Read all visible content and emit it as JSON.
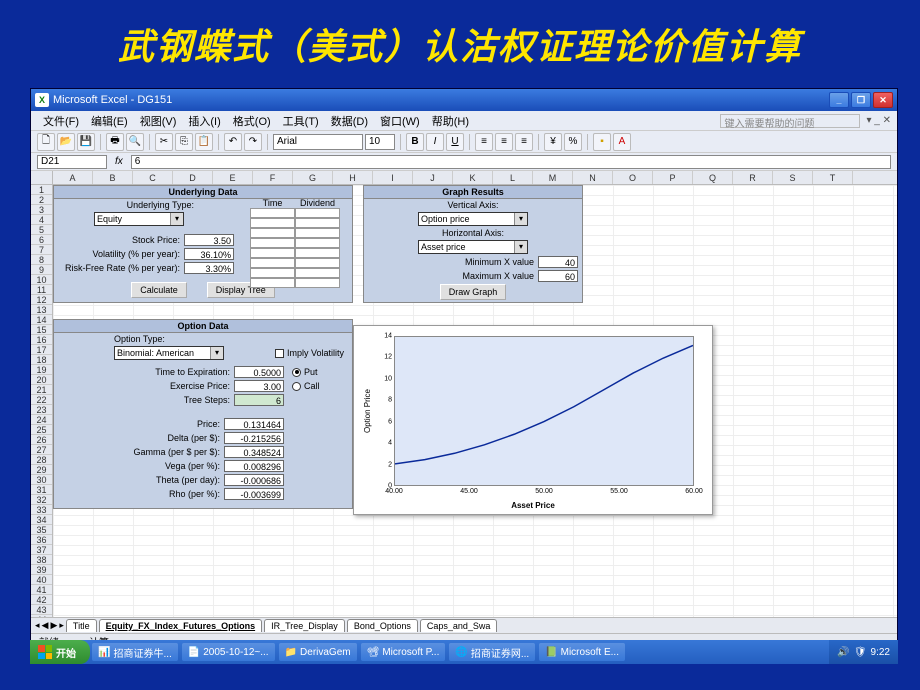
{
  "slide_title": "武钢蝶式（美式）认沽权证理论价值计算",
  "window": {
    "title": "Microsoft Excel - DG151"
  },
  "menubar": {
    "items": [
      "文件(F)",
      "编辑(E)",
      "视图(V)",
      "插入(I)",
      "格式(O)",
      "工具(T)",
      "数据(D)",
      "窗口(W)",
      "帮助(H)"
    ],
    "help_placeholder": "键入需要帮助的问题"
  },
  "formatbar": {
    "font": "Arial",
    "size": "10"
  },
  "namebox": {
    "cell": "D21",
    "fx": "fx",
    "value": "6"
  },
  "columns": [
    "A",
    "B",
    "C",
    "D",
    "E",
    "F",
    "G",
    "H",
    "I",
    "J",
    "K",
    "L",
    "M",
    "N",
    "O",
    "P",
    "Q",
    "R",
    "S",
    "T"
  ],
  "row_count": 45,
  "underlying": {
    "title": "Underlying Data",
    "type_label": "Underlying Type:",
    "type_value": "Equity",
    "time_label": "Time",
    "dividend_label": "Dividend",
    "stock_price_label": "Stock Price:",
    "stock_price": "3.50",
    "vol_label": "Volatility (% per year):",
    "vol": "36.10%",
    "rf_label": "Risk-Free Rate (% per year):",
    "rf": "3.30%",
    "calc_btn": "Calculate",
    "tree_btn": "Display Tree"
  },
  "graph": {
    "title": "Graph Results",
    "vaxis_label": "Vertical Axis:",
    "vaxis": "Option price",
    "haxis_label": "Horizontal Axis:",
    "haxis": "Asset price",
    "minx_label": "Minimum X value",
    "minx": "40",
    "maxx_label": "Maximum X value",
    "maxx": "60",
    "draw_btn": "Draw Graph"
  },
  "option": {
    "title": "Option Data",
    "type_label": "Option Type:",
    "type_value": "Binomial: American",
    "imply_label": "Imply Volatility",
    "tte_label": "Time to Expiration:",
    "tte": "0.5000",
    "strike_label": "Exercise Price:",
    "strike": "3.00",
    "steps_label": "Tree Steps:",
    "steps": "6",
    "put_label": "Put",
    "call_label": "Call",
    "price_label": "Price:",
    "price": "0.131464",
    "delta_label": "Delta (per $):",
    "delta": "-0.215256",
    "gamma_label": "Gamma (per $ per $):",
    "gamma": "0.348524",
    "vega_label": "Vega (per %):",
    "vega": "0.008296",
    "theta_label": "Theta (per day):",
    "theta": "-0.000686",
    "rho_label": "Rho (per %):",
    "rho": "-0.003699"
  },
  "chart_data": {
    "type": "line",
    "title": "",
    "xlabel": "Asset Price",
    "ylabel": "Option Price",
    "xlim": [
      40,
      60
    ],
    "ylim": [
      0,
      14
    ],
    "x": [
      40,
      42,
      44,
      46,
      48,
      50,
      52,
      54,
      56,
      58,
      60
    ],
    "values": [
      2.0,
      2.4,
      3.0,
      3.8,
      4.8,
      6.0,
      7.4,
      9.0,
      10.6,
      12.0,
      13.2
    ],
    "xticks": [
      40.0,
      45.0,
      50.0,
      55.0,
      60.0
    ],
    "yticks": [
      0,
      2,
      4,
      6,
      8,
      10,
      12,
      14
    ]
  },
  "sheet_tabs": {
    "nav": [
      "◂",
      "◀",
      "▶",
      "▸"
    ],
    "tabs": [
      "Title",
      "Equity_FX_Index_Futures_Options",
      "IR_Tree_Display",
      "Bond_Options",
      "Caps_and_Swa"
    ],
    "active": 1
  },
  "statusbar": {
    "ready": "就绪",
    "mode": "计算"
  },
  "taskbar": {
    "start": "开始",
    "items": [
      "招商证券牛...",
      "2005-10-12~...",
      "DerivaGem",
      "Microsoft P...",
      "招商证券网...",
      "Microsoft E..."
    ],
    "time": "9:22"
  }
}
